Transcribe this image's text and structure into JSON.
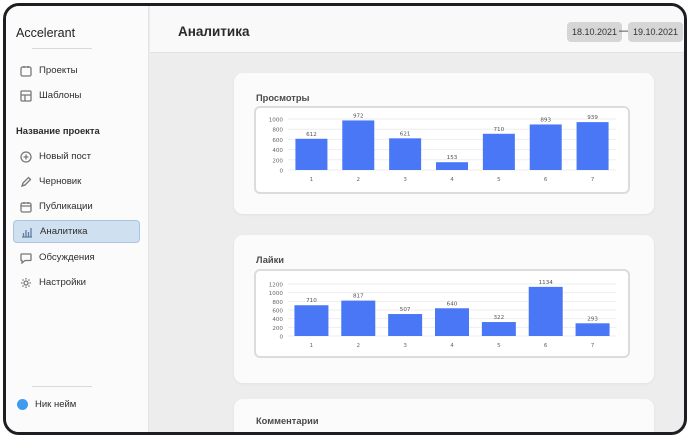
{
  "app": {
    "brand": "Accelerant"
  },
  "sidebar": {
    "top_items": [
      {
        "label": "Проекты",
        "icon": "projects-icon"
      },
      {
        "label": "Шаблоны",
        "icon": "templates-icon"
      }
    ],
    "section_title": "Название проекта",
    "project_items": [
      {
        "label": "Новый пост",
        "icon": "plus-circle-icon"
      },
      {
        "label": "Черновик",
        "icon": "pencil-icon"
      },
      {
        "label": "Публикации",
        "icon": "calendar-icon"
      },
      {
        "label": "Аналитика",
        "icon": "bar-chart-icon",
        "active": true
      },
      {
        "label": "Обсуждения",
        "icon": "chat-icon"
      },
      {
        "label": "Настройки",
        "icon": "gear-icon"
      }
    ],
    "user": {
      "name": "Ник нейм",
      "avatar_color": "#3d9cf0"
    }
  },
  "header": {
    "title": "Аналитика",
    "date_from": "18.10.2021",
    "date_separator": "—",
    "date_to": "19.10.2021"
  },
  "cards": [
    {
      "title": "Просмотры"
    },
    {
      "title": "Лайки"
    },
    {
      "title": "Комментарии"
    }
  ],
  "colors": {
    "bar": "#4a77f5",
    "active_nav": "#cfe0f0",
    "accent": "#3d9cf0"
  },
  "chart_data": [
    {
      "type": "bar",
      "title": "Просмотры",
      "categories": [
        "1",
        "2",
        "3",
        "4",
        "5",
        "6",
        "7"
      ],
      "values": [
        612,
        972,
        621,
        153,
        710,
        893,
        939
      ],
      "yticks": [
        0,
        200,
        400,
        600,
        800,
        1000
      ],
      "ylim": [
        0,
        1000
      ],
      "grid": true,
      "data_labels": true
    },
    {
      "type": "bar",
      "title": "Лайки",
      "categories": [
        "1",
        "2",
        "3",
        "4",
        "5",
        "6",
        "7"
      ],
      "values": [
        710,
        817,
        507,
        640,
        322,
        1134,
        293
      ],
      "yticks": [
        0,
        200,
        400,
        600,
        800,
        1000,
        1200
      ],
      "ylim": [
        0,
        1200
      ],
      "grid": true,
      "data_labels": true
    }
  ]
}
